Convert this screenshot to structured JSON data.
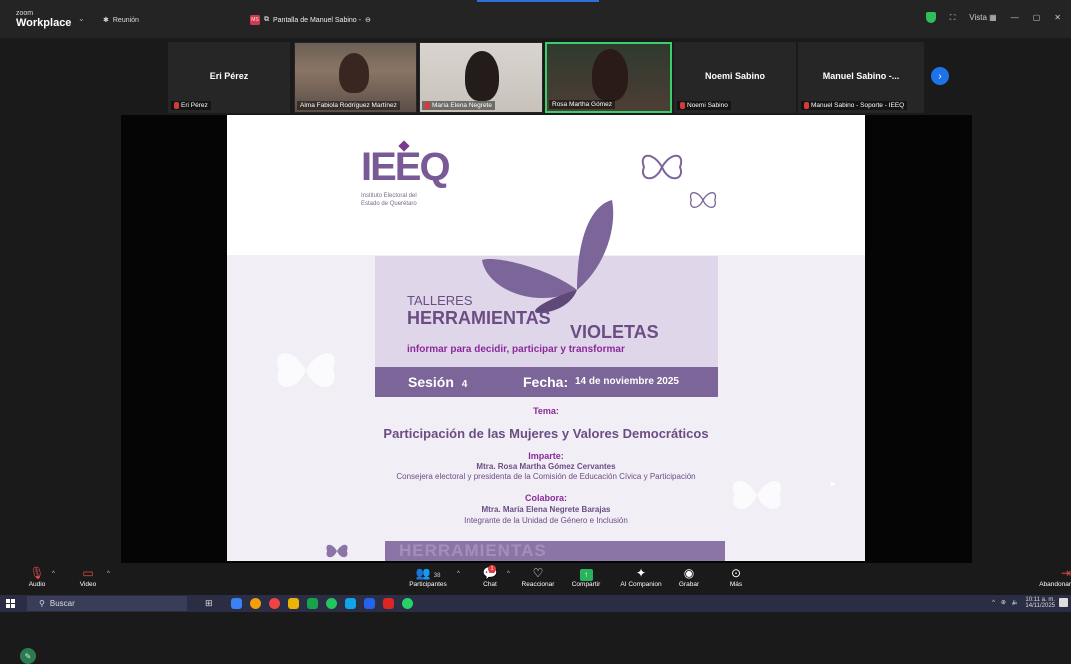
{
  "app": {
    "brand_small": "zoom",
    "brand_name": "Workplace",
    "meeting_label": "Reunión",
    "share_tab_label": "Pantalla de Manuel Sabino -",
    "share_tab_badge": "MS",
    "view_label": "Vista"
  },
  "participants": [
    {
      "display_name": "Eri Pérez",
      "label": "Eri Pérez",
      "video": false
    },
    {
      "display_name": "",
      "label": "Alma Fabiola Rodríguez Martínez",
      "video": true
    },
    {
      "display_name": "",
      "label": "María Elena Negrete",
      "video": true
    },
    {
      "display_name": "",
      "label": "Rosa Martha Gómez",
      "video": true,
      "active": true
    },
    {
      "display_name": "Noemi Sabino",
      "label": "Noemi Sabino",
      "video": false
    },
    {
      "display_name": "Manuel Sabino -...",
      "label": "Manuel Sabino - Soporte - IEEQ",
      "video": false
    }
  ],
  "slide": {
    "logo": "IEEQ",
    "logo_sub_1": "Instituto Electoral del",
    "logo_sub_2": "Estado de Querétaro",
    "talleres": "TALLERES",
    "herramientas": "HERRAMIENTAS",
    "violetas": "VIOLETAS",
    "tagline": "informar para decidir, participar y transformar",
    "session_label": "Sesión",
    "session_number": "4",
    "date_label": "Fecha:",
    "date_value": "14 de noviembre 2025",
    "tema_label": "Tema:",
    "tema": "Participación de las Mujeres y Valores Democráticos",
    "imparte_label": "Imparte:",
    "imparte_name": "Mtra. Rosa Martha Gómez Cervantes",
    "imparte_role": "Consejera electoral y presidenta de la Comisión de Educación Cívica y Participación",
    "colabora_label": "Colabora:",
    "colabora_name": "Mtra. María Elena Negrete Barajas",
    "colabora_role": "Integrante de la Unidad de Género e Inclusión",
    "bottom_partial": "HERRAMIENTAS"
  },
  "toolbar": {
    "audio": "Audio",
    "video": "Video",
    "participants": "Participantes",
    "participants_count": "38",
    "chat": "Chat",
    "chat_badge": "1",
    "react": "Reaccionar",
    "share": "Compartir",
    "ai": "AI Companion",
    "record": "Grabar",
    "more": "Más",
    "leave": "Abandonar"
  },
  "taskbar": {
    "search_placeholder": "Buscar",
    "time": "10:11 a. m.",
    "date": "14/11/2025"
  },
  "colors": {
    "zoom_blue": "#1e73e8",
    "active_green": "#37d06a",
    "slide_purple": "#7c6598"
  }
}
